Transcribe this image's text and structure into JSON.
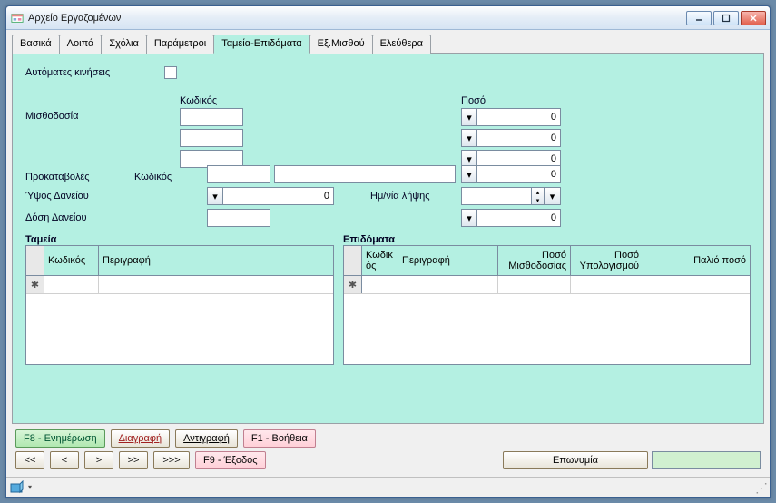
{
  "window": {
    "title": "Αρχείο Εργαζομένων"
  },
  "tabs": [
    {
      "label": "Βασικά"
    },
    {
      "label": "Λοιπά"
    },
    {
      "label": "Σχόλια"
    },
    {
      "label": "Παράμετροι"
    },
    {
      "label": "Ταμεία-Επιδόματα"
    },
    {
      "label": "Εξ.Μισθού"
    },
    {
      "label": "Ελεύθερα"
    }
  ],
  "form": {
    "auto_moves_label": "Αυτόματες κινήσεις",
    "code_label": "Κωδικός",
    "amount_label": "Ποσό",
    "payroll_label": "Μισθοδοσία",
    "advances_label": "Προκαταβολές",
    "advances_code_label": "Κωδικός",
    "loan_amount_label": "Ύψος Δανείου",
    "loan_date_label": "Ημ/νία λήψης",
    "loan_installment_label": "Δόση Δανείου",
    "amount_values": [
      "0",
      "0",
      "0",
      "0",
      "0"
    ],
    "loan_amount_value": "0"
  },
  "tamia": {
    "title": "Ταμεία",
    "columns": [
      "Κωδικός",
      "Περιγραφή"
    ]
  },
  "epidomata": {
    "title": "Επιδόματα",
    "columns": [
      "Κωδικ\nός",
      "Περιγραφή",
      "Ποσό Μισθοδοσίας",
      "Ποσό Υπολογισμού",
      "Παλιό ποσό"
    ]
  },
  "buttons": {
    "update": "F8 - Ενημέρωση",
    "delete": "Διαγραφή",
    "copy": "Αντιγραφή",
    "help": "F1 - Βοήθεια",
    "exit": "F9 - Έξοδος",
    "eponymia": "Επωνυμία"
  },
  "nav": {
    "first": "<<",
    "prev": "<",
    "next": ">",
    "last": ">>",
    "lastplus": ">>>"
  }
}
